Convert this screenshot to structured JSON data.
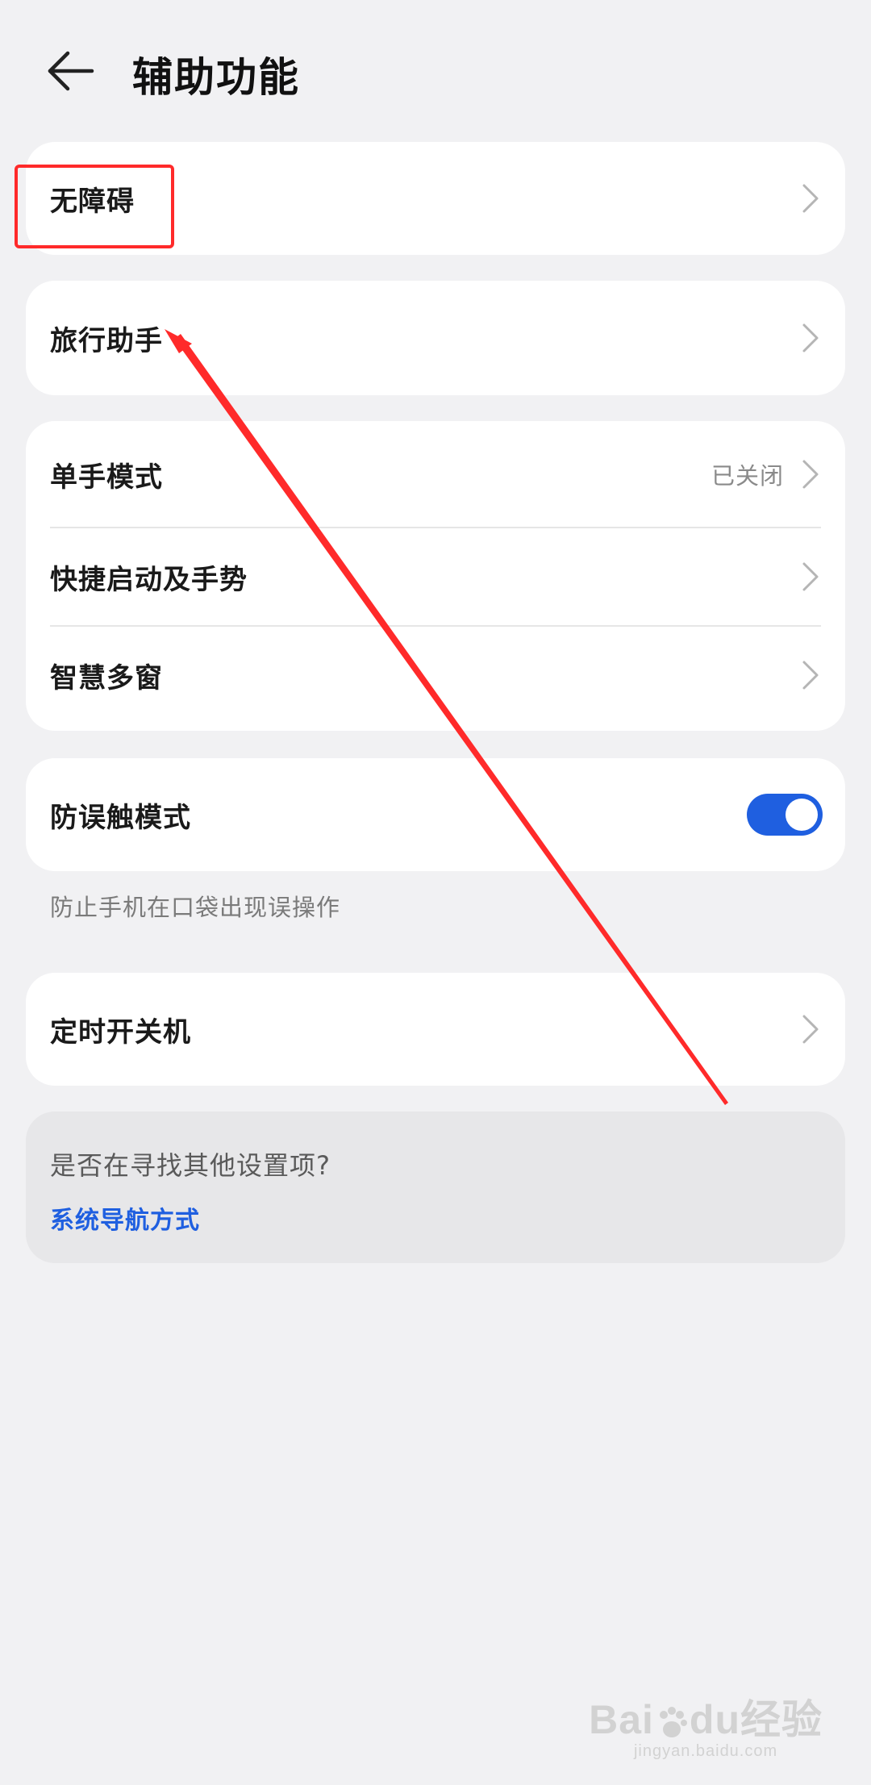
{
  "header": {
    "title": "辅助功能",
    "back_icon": "arrow-left-icon"
  },
  "cards": {
    "accessibility": {
      "label": "无障碍"
    },
    "travel_assistant": {
      "label": "旅行助手"
    },
    "group": {
      "one_hand_mode": {
        "label": "单手模式",
        "value": "已关闭"
      },
      "shortcuts_gestures": {
        "label": "快捷启动及手势"
      },
      "smart_multi_window": {
        "label": "智慧多窗"
      }
    },
    "pocket_mode": {
      "label": "防误触模式",
      "enabled": true,
      "hint": "防止手机在口袋出现误操作"
    },
    "scheduled_power": {
      "label": "定时开关机"
    }
  },
  "search_card": {
    "question": "是否在寻找其他设置项?",
    "link": "系统导航方式"
  },
  "watermark": {
    "logo_left": "Bai",
    "logo_right": "du",
    "logo_suffix": "经验",
    "domain": "jingyan.baidu.com"
  },
  "colors": {
    "background": "#f1f1f3",
    "card": "#ffffff",
    "accent": "#1f5fe0",
    "annotation": "#ff2a2a"
  }
}
